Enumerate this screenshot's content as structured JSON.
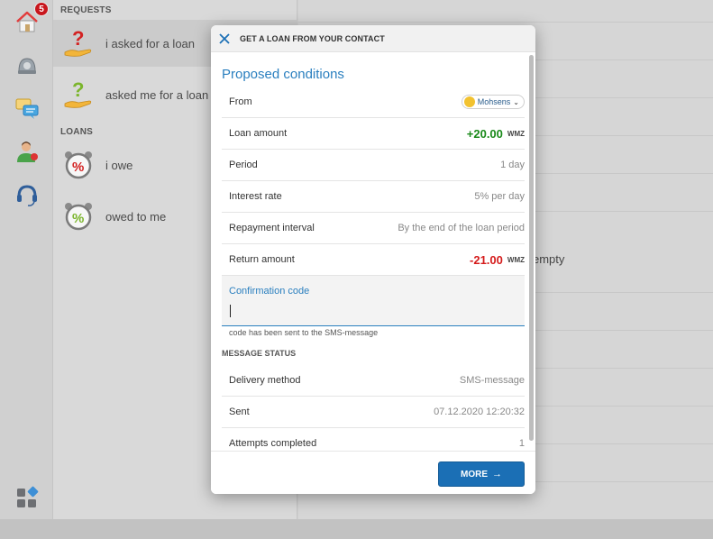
{
  "sidebar": {
    "badge_count": "5",
    "icons": [
      "home-icon",
      "safe-icon",
      "chat-icon",
      "contact-icon",
      "support-icon",
      "apps-icon"
    ],
    "safe_number": "5"
  },
  "requests_panel": {
    "requests_heading": "REQUESTS",
    "loans_heading": "LOANS",
    "items": [
      {
        "label": "i asked for a loan",
        "icon": "question-hand-red-icon"
      },
      {
        "label": "asked me for a loan",
        "icon": "question-hand-green-icon"
      },
      {
        "label": "i owe",
        "icon": "percent-clock-red-icon"
      },
      {
        "label": "owed to me",
        "icon": "percent-clock-green-icon"
      }
    ]
  },
  "background": {
    "empty_text": "empty"
  },
  "modal": {
    "title": "GET A LOAN FROM YOUR CONTACT",
    "heading": "Proposed conditions",
    "from": {
      "label": "From",
      "contact": "Mohsens"
    },
    "loan_amount": {
      "label": "Loan amount",
      "value": "+20.00",
      "unit": "WMZ"
    },
    "period": {
      "label": "Period",
      "value": "1 day"
    },
    "interest_rate": {
      "label": "Interest rate",
      "value": "5% per day"
    },
    "repayment": {
      "label": "Repayment interval",
      "value": "By the end of the loan period"
    },
    "return_amount": {
      "label": "Return amount",
      "value": "-21.00",
      "unit": "WMZ"
    },
    "confirmation": {
      "label": "Confirmation code",
      "value": "",
      "hint": "code has been sent to the SMS-message"
    },
    "message_status": {
      "heading": "MESSAGE STATUS",
      "delivery": {
        "label": "Delivery method",
        "value": "SMS-message"
      },
      "sent": {
        "label": "Sent",
        "value": "07.12.2020 12:20:32"
      },
      "attempts": {
        "label": "Attempts completed",
        "value": "1"
      }
    },
    "more_label": "MORE",
    "accent_color": "#2a7fbf",
    "positive_color": "#1a8a1a",
    "negative_color": "#d51c1c",
    "button_color": "#1b6fb5"
  }
}
